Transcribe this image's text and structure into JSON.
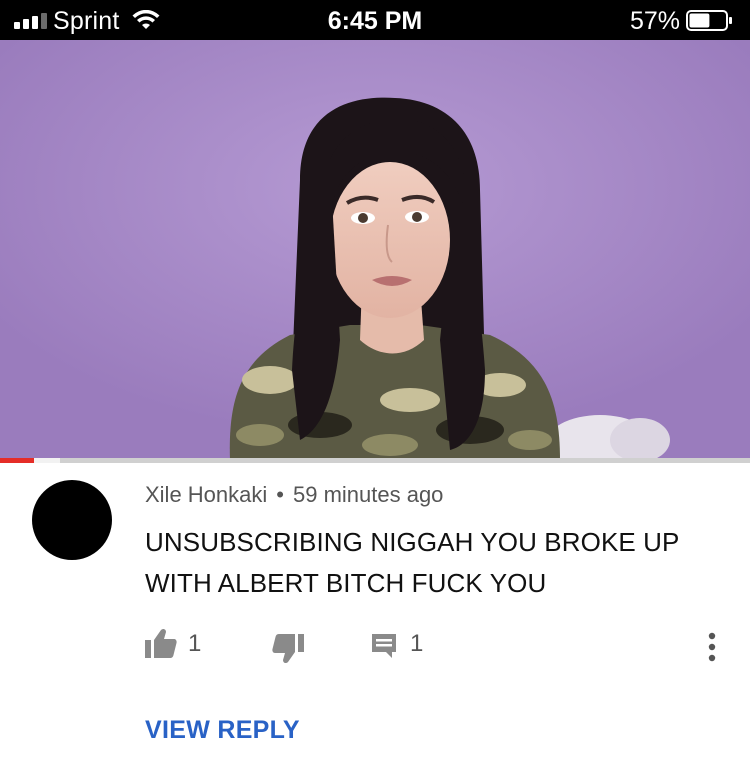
{
  "status_bar": {
    "carrier": "Sprint",
    "time": "6:45 PM",
    "battery_percent": "57%",
    "battery_level": 0.57,
    "signal_bars": 3
  },
  "video": {
    "progress_fraction": 0.045,
    "buffer_fraction": 0.08
  },
  "comment": {
    "author": "Xile Honkaki",
    "separator": "•",
    "timestamp": "59 minutes ago",
    "text": "UNSUBSCRIBING NIGGAH YOU BROKE UP WITH ALBERT BITCH FUCK YOU",
    "like_count": "1",
    "reply_count": "1",
    "view_reply_label": "VIEW REPLY"
  },
  "icons": {
    "like": "thumbs-up-icon",
    "dislike": "thumbs-down-icon",
    "reply": "comment-icon",
    "more": "more-vertical-icon"
  },
  "colors": {
    "accent_link": "#2962c6",
    "progress": "#e52d27",
    "wall": "#a98cc9"
  }
}
